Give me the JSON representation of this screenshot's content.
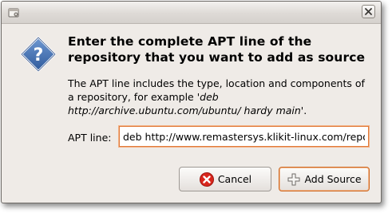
{
  "window": {
    "title": ""
  },
  "dialog": {
    "heading": "Enter the complete APT line of the repository that you want to add as source",
    "description_prefix": "The APT line includes the type, location and components of a repository, for example  '",
    "description_example": "deb http://archive.ubuntu.com/ubuntu/ hardy main",
    "description_suffix": "'.",
    "apt_label": "APT line:",
    "apt_value": "deb http://www.remastersys.klikit-linux.com/repository"
  },
  "buttons": {
    "cancel_label": "Cancel",
    "add_label": "Add Source"
  },
  "icons": {
    "dialog": "question-icon",
    "cancel": "cancel-icon",
    "add": "add-icon",
    "close": "close-icon",
    "menu": "window-menu-icon"
  },
  "colors": {
    "window_bg": "#efebe7",
    "focus_accent": "#e07a3a",
    "question_icon": "#3e6cad"
  }
}
